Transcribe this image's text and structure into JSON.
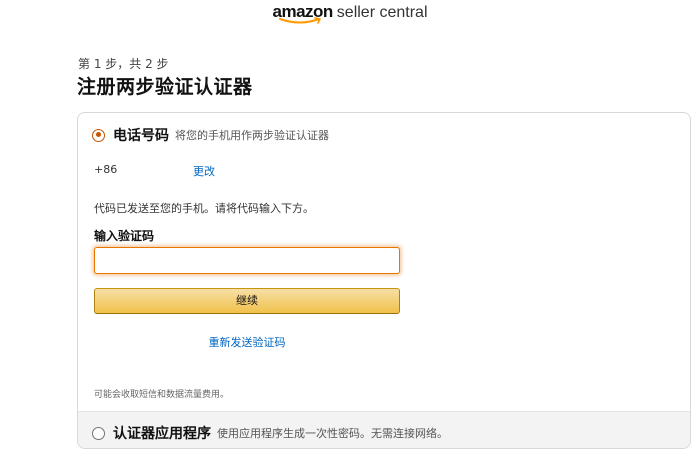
{
  "logo": {
    "brand": "amazon",
    "product": "seller central"
  },
  "step": {
    "text": "第 1 步，共 2 步"
  },
  "page": {
    "title": "注册两步验证认证器"
  },
  "phone_option": {
    "title": "电话号码",
    "desc": "将您的手机用作两步验证认证器",
    "selected": true,
    "phone_prefix": "+86",
    "change_label": "更改",
    "sent_message": "代码已发送至您的手机。请将代码输入下方。",
    "code_label": "输入验证码",
    "code_value": "",
    "continue_label": "继续",
    "resend_label": "重新发送验证码",
    "fee_note": "可能会收取短信和数据流量费用。"
  },
  "authenticator_option": {
    "title": "认证器应用程序",
    "desc": "使用应用程序生成一次性密码。无需连接网络。",
    "selected": false
  },
  "colors": {
    "accent_orange": "#c45500",
    "link_blue": "#0066c0",
    "button_yellow": "#f0c14b",
    "input_focus": "#e77600"
  }
}
